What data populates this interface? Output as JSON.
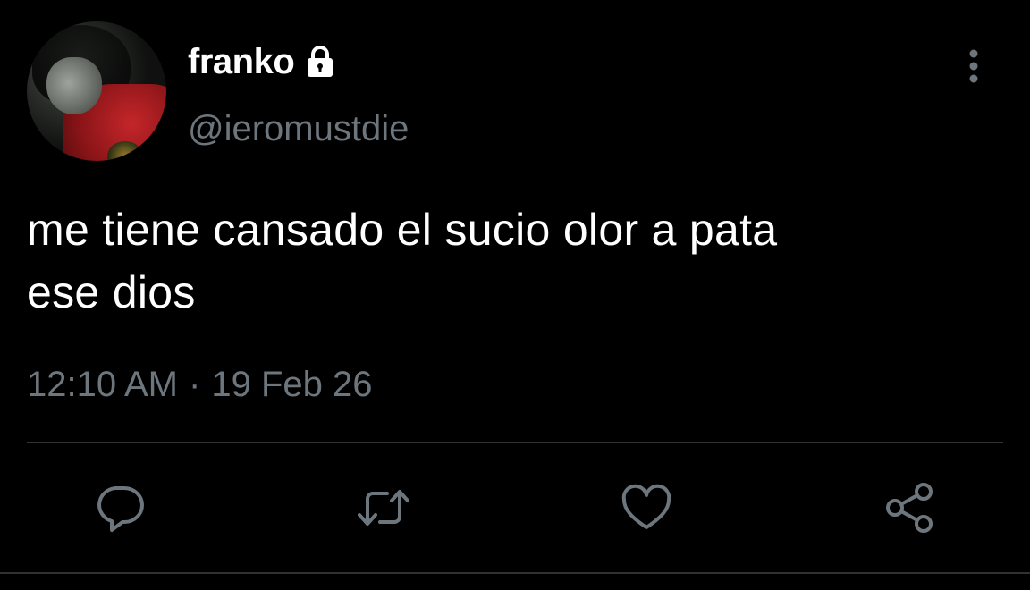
{
  "user": {
    "display_name": "franko",
    "handle": "@ieromustdie",
    "avatar": "profile-photo",
    "protected_icon": "lock-icon"
  },
  "tweet": {
    "text_line1": "me tiene cansado el sucio olor a pata",
    "text_line2": "ese dios",
    "time": "12:10 AM",
    "separator": "·",
    "date": "19 Feb 26"
  },
  "actions": [
    {
      "name": "reply",
      "icon": "reply-icon"
    },
    {
      "name": "retweet",
      "icon": "retweet-icon"
    },
    {
      "name": "like",
      "icon": "heart-icon"
    },
    {
      "name": "share",
      "icon": "share-icon"
    }
  ],
  "menu_icon": "more-vertical-icon",
  "colors": {
    "background": "#000000",
    "primary_text": "#ffffff",
    "secondary_text": "#6e767d",
    "divider": "#2f3336"
  }
}
